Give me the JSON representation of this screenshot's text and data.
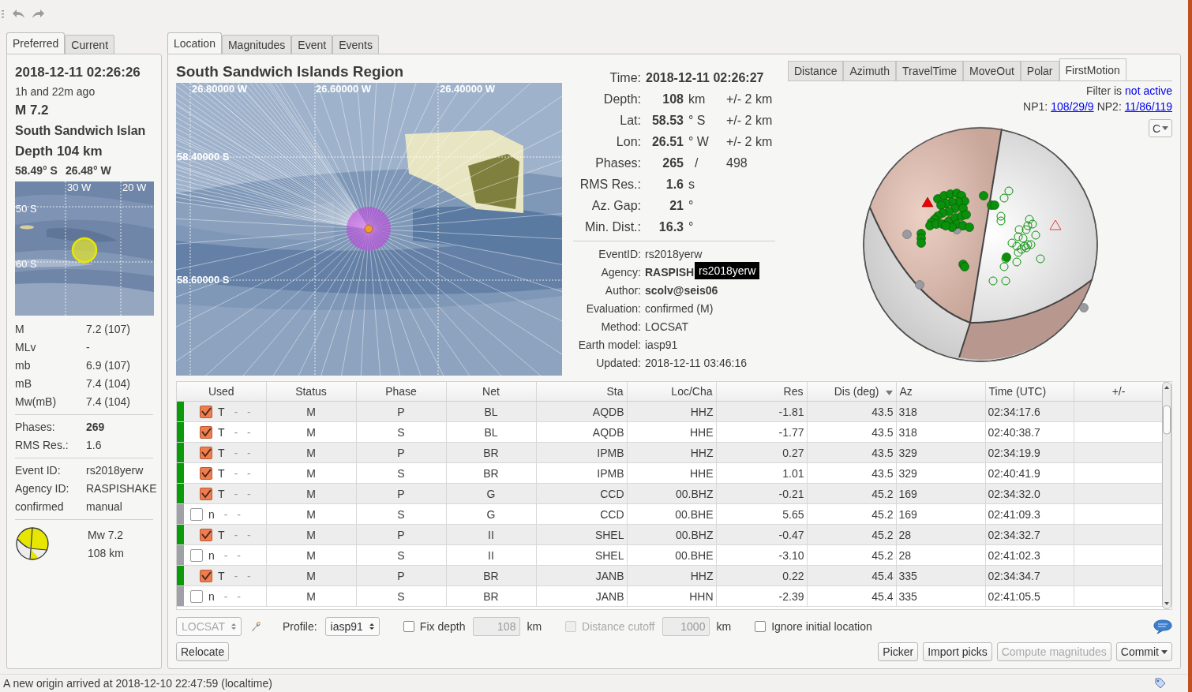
{
  "left_panel": {
    "tabs": [
      {
        "label": "Preferred",
        "selected": true
      },
      {
        "label": "Current",
        "selected": false
      }
    ],
    "time": "2018-12-11 02:26:26",
    "ago": "1h and 22m ago",
    "magnitude": "M  7.2",
    "region": "South Sandwich Islan",
    "depth": "Depth  104 km",
    "latitude": "58.49° S",
    "longitude": "26.48° W",
    "map": {
      "lon_labels": [
        "30 W",
        "20 W"
      ],
      "lat_labels": [
        "50 S",
        "60 S"
      ]
    },
    "magnitudes": [
      {
        "type": "M",
        "value": "7.2 (107)"
      },
      {
        "type": "MLv",
        "value": "-"
      },
      {
        "type": "mb",
        "value": "6.9 (107)"
      },
      {
        "type": "mB",
        "value": "7.4 (104)"
      },
      {
        "type": "Mw(mB)",
        "value": "7.4 (104)"
      }
    ],
    "quality": [
      {
        "label": "Phases:",
        "value": "269",
        "bold": true
      },
      {
        "label": "RMS Res.:",
        "value": "1.6",
        "bold": false
      }
    ],
    "ids": [
      {
        "label": "Event ID:",
        "value": "rs2018yerw"
      },
      {
        "label": "Agency ID:",
        "value": "RASPISHAKE"
      },
      {
        "label": "confirmed",
        "value": "manual"
      }
    ],
    "mechanism": {
      "magnitude": "Mw 7.2",
      "depth": "108 km"
    }
  },
  "tabs": [
    {
      "label": "Location",
      "selected": true
    },
    {
      "label": "Magnitudes",
      "selected": false
    },
    {
      "label": "Event",
      "selected": false
    },
    {
      "label": "Events",
      "selected": false
    }
  ],
  "location": {
    "region": "South Sandwich Islands Region",
    "map": {
      "lon_labels": [
        "26.80000 W",
        "26.60000 W",
        "26.40000 W"
      ],
      "lat_labels": [
        "58.40000 S",
        "58.60000 S"
      ]
    },
    "summary": [
      {
        "label": "Time:",
        "value": "2018-12-11 02:26:27"
      },
      {
        "label": "Depth:",
        "value": "108",
        "unit": "km",
        "error": "+/- 2  km"
      },
      {
        "label": "Lat:",
        "value": "58.53",
        "unit": "° S",
        "error": "+/- 2  km"
      },
      {
        "label": "Lon:",
        "value": "26.51",
        "unit": "° W",
        "error": "+/- 2  km"
      },
      {
        "label": "Phases:",
        "value": "265",
        "separator": "/",
        "total": "498"
      },
      {
        "label": "RMS Res.:",
        "value": "1.6",
        "unit": "s"
      },
      {
        "label": "Az. Gap:",
        "value": "21",
        "unit": "°"
      },
      {
        "label": "Min. Dist.:",
        "value": "16.3",
        "unit": "°"
      }
    ],
    "details": [
      {
        "label": "EventID:",
        "value": "rs2018yerw",
        "bold": false
      },
      {
        "label": "Agency:",
        "value": "RASPISH",
        "bold": true
      },
      {
        "label": "Author:",
        "value": "scolv@seis06",
        "bold": true
      },
      {
        "label": "Evaluation:",
        "value": "confirmed (M)",
        "bold": false
      },
      {
        "label": "Method:",
        "value": "LOCSAT",
        "bold": false
      },
      {
        "label": "Earth model:",
        "value": "iasp91",
        "bold": false
      },
      {
        "label": "Updated:",
        "value": "2018-12-11 03:46:16",
        "bold": false
      }
    ],
    "tooltip": "rs2018yerw"
  },
  "plot_tabs": [
    {
      "label": "Distance",
      "selected": false
    },
    {
      "label": "Azimuth",
      "selected": false
    },
    {
      "label": "TravelTime",
      "selected": false
    },
    {
      "label": "MoveOut",
      "selected": false
    },
    {
      "label": "Polar",
      "selected": false
    },
    {
      "label": "FirstMotion",
      "selected": true
    }
  ],
  "first_motion": {
    "filter_label": "Filter is",
    "filter_state": "not active",
    "np1_label": "NP1:",
    "np1": "108/29/9",
    "np2_label": "NP2:",
    "np2": "11/86/119",
    "mode_button": "C"
  },
  "table": {
    "columns": [
      {
        "label": "Used",
        "sorted": false
      },
      {
        "label": "Status",
        "sorted": false
      },
      {
        "label": "Phase",
        "sorted": false
      },
      {
        "label": "Net",
        "sorted": false
      },
      {
        "label": "Sta",
        "sorted": false
      },
      {
        "label": "Loc/Cha",
        "sorted": false
      },
      {
        "label": "Res",
        "sorted": false
      },
      {
        "label": "Dis (deg)",
        "sorted": true
      },
      {
        "label": "Az",
        "sorted": false
      },
      {
        "label": "Time (UTC)",
        "sorted": false
      },
      {
        "label": "+/-",
        "sorted": false
      }
    ],
    "rows": [
      {
        "used": true,
        "flag": "T",
        "weights": "-   -",
        "status": "M",
        "phase": "P",
        "net": "BL",
        "sta": "AQDB",
        "loccha": "HHZ",
        "res": "-1.81",
        "dis": "43.5",
        "az": "318",
        "time": "02:34:17.6"
      },
      {
        "used": true,
        "flag": "T",
        "weights": "-   -",
        "status": "M",
        "phase": "S",
        "net": "BL",
        "sta": "AQDB",
        "loccha": "HHE",
        "res": "-1.77",
        "dis": "43.5",
        "az": "318",
        "time": "02:40:38.7"
      },
      {
        "used": true,
        "flag": "T",
        "weights": "-   -",
        "status": "M",
        "phase": "P",
        "net": "BR",
        "sta": "IPMB",
        "loccha": "HHZ",
        "res": "0.27",
        "dis": "43.5",
        "az": "329",
        "time": "02:34:19.9"
      },
      {
        "used": true,
        "flag": "T",
        "weights": "-   -",
        "status": "M",
        "phase": "S",
        "net": "BR",
        "sta": "IPMB",
        "loccha": "HHE",
        "res": "1.01",
        "dis": "43.5",
        "az": "329",
        "time": "02:40:41.9"
      },
      {
        "used": true,
        "flag": "T",
        "weights": "-   -",
        "status": "M",
        "phase": "P",
        "net": "G",
        "sta": "CCD",
        "loccha": "00.BHZ",
        "res": "-0.21",
        "dis": "45.2",
        "az": "169",
        "time": "02:34:32.0"
      },
      {
        "used": false,
        "flag": "n",
        "weights": "-   -",
        "status": "M",
        "phase": "S",
        "net": "G",
        "sta": "CCD",
        "loccha": "00.BHE",
        "res": "5.65",
        "dis": "45.2",
        "az": "169",
        "time": "02:41:09.3"
      },
      {
        "used": true,
        "flag": "T",
        "weights": "-   -",
        "status": "M",
        "phase": "P",
        "net": "II",
        "sta": "SHEL",
        "loccha": "00.BHZ",
        "res": "-0.47",
        "dis": "45.2",
        "az": "28",
        "time": "02:34:32.7"
      },
      {
        "used": false,
        "flag": "n",
        "weights": "-   -",
        "status": "M",
        "phase": "S",
        "net": "II",
        "sta": "SHEL",
        "loccha": "00.BHE",
        "res": "-3.10",
        "dis": "45.2",
        "az": "28",
        "time": "02:41:02.3"
      },
      {
        "used": true,
        "flag": "T",
        "weights": "-   -",
        "status": "M",
        "phase": "P",
        "net": "BR",
        "sta": "JANB",
        "loccha": "HHZ",
        "res": "0.22",
        "dis": "45.4",
        "az": "335",
        "time": "02:34:34.7"
      },
      {
        "used": false,
        "flag": "n",
        "weights": "-   -",
        "status": "M",
        "phase": "S",
        "net": "BR",
        "sta": "JANB",
        "loccha": "HHN",
        "res": "-2.39",
        "dis": "45.4",
        "az": "335",
        "time": "02:41:05.5"
      }
    ]
  },
  "controls": {
    "method": {
      "value": "LOCSAT",
      "disabled": true
    },
    "profile_label": "Profile:",
    "profile": "iasp91",
    "fix_depth": {
      "label": "Fix depth",
      "checked": false,
      "disabled": false
    },
    "depth": {
      "value": "108",
      "unit": "km",
      "disabled": true
    },
    "distance_cutoff": {
      "label": "Distance cutoff",
      "checked": false,
      "disabled": true
    },
    "cutoff": {
      "value": "1000",
      "unit": "km",
      "disabled": true
    },
    "ignore_initial": {
      "label": "Ignore initial location",
      "checked": false,
      "disabled": false
    }
  },
  "buttons_left": [
    {
      "label": "Relocate",
      "disabled": false,
      "menu": false
    }
  ],
  "buttons_right": [
    {
      "label": "Picker",
      "disabled": false,
      "menu": false
    },
    {
      "label": "Import picks",
      "disabled": false,
      "menu": false
    },
    {
      "label": "Compute magnitudes",
      "disabled": true,
      "menu": false
    },
    {
      "label": "Commit",
      "disabled": false,
      "menu": true
    }
  ],
  "status_bar": "A new origin arrived at 2018-12-10 22:47:59 (localtime)"
}
